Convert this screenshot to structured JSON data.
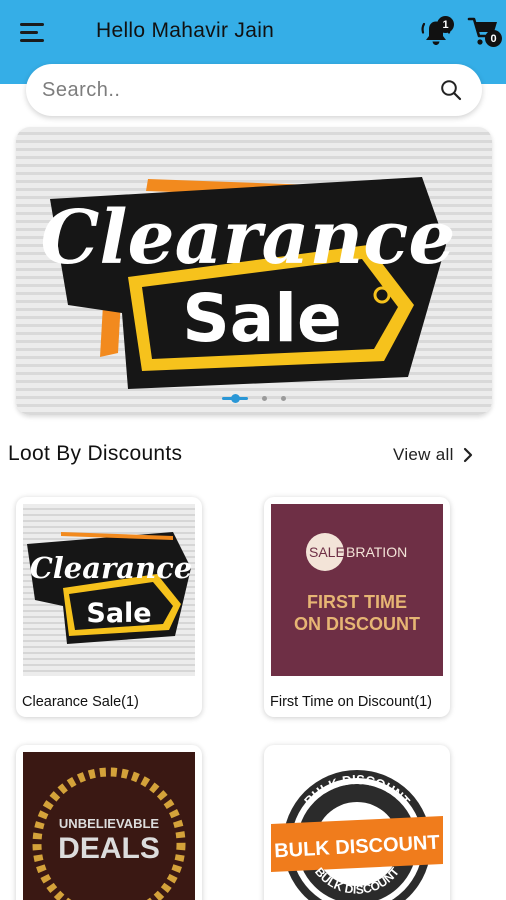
{
  "header": {
    "greeting": "Hello Mahavir Jain",
    "notification_count": "1",
    "cart_count": "0",
    "background_color": "#35aee7"
  },
  "search": {
    "placeholder": "Search..",
    "icon": "search-icon"
  },
  "banner": {
    "line1": "Clearance",
    "line2": "Sale",
    "slide_count": 3,
    "active_slide": 1,
    "indicator_color": "#2a97d6"
  },
  "section": {
    "title": "Loot By Discounts",
    "view_all_label": "View all"
  },
  "cards": [
    {
      "label": "Clearance Sale(1)",
      "image_line1": "Clearance",
      "image_line2": "Sale"
    },
    {
      "label": "First Time on Discount(1)",
      "image_badge": "SALE",
      "image_badge_rest": "BRATION",
      "image_line1": "FIRST TIME",
      "image_line2": "ON DISCOUNT",
      "background_color": "#6e2f45"
    },
    {
      "label": "",
      "image_line1": "UNBELIEVABLE",
      "image_line2": "DEALS",
      "background_color": "#3a1813"
    },
    {
      "label": "",
      "image_ring_top": "BULK DISCOUNT",
      "image_ribbon": "BULK DISCOUNT",
      "image_ring_bottom": "BULK DISCOUNT",
      "ribbon_color": "#f07c1c"
    }
  ]
}
